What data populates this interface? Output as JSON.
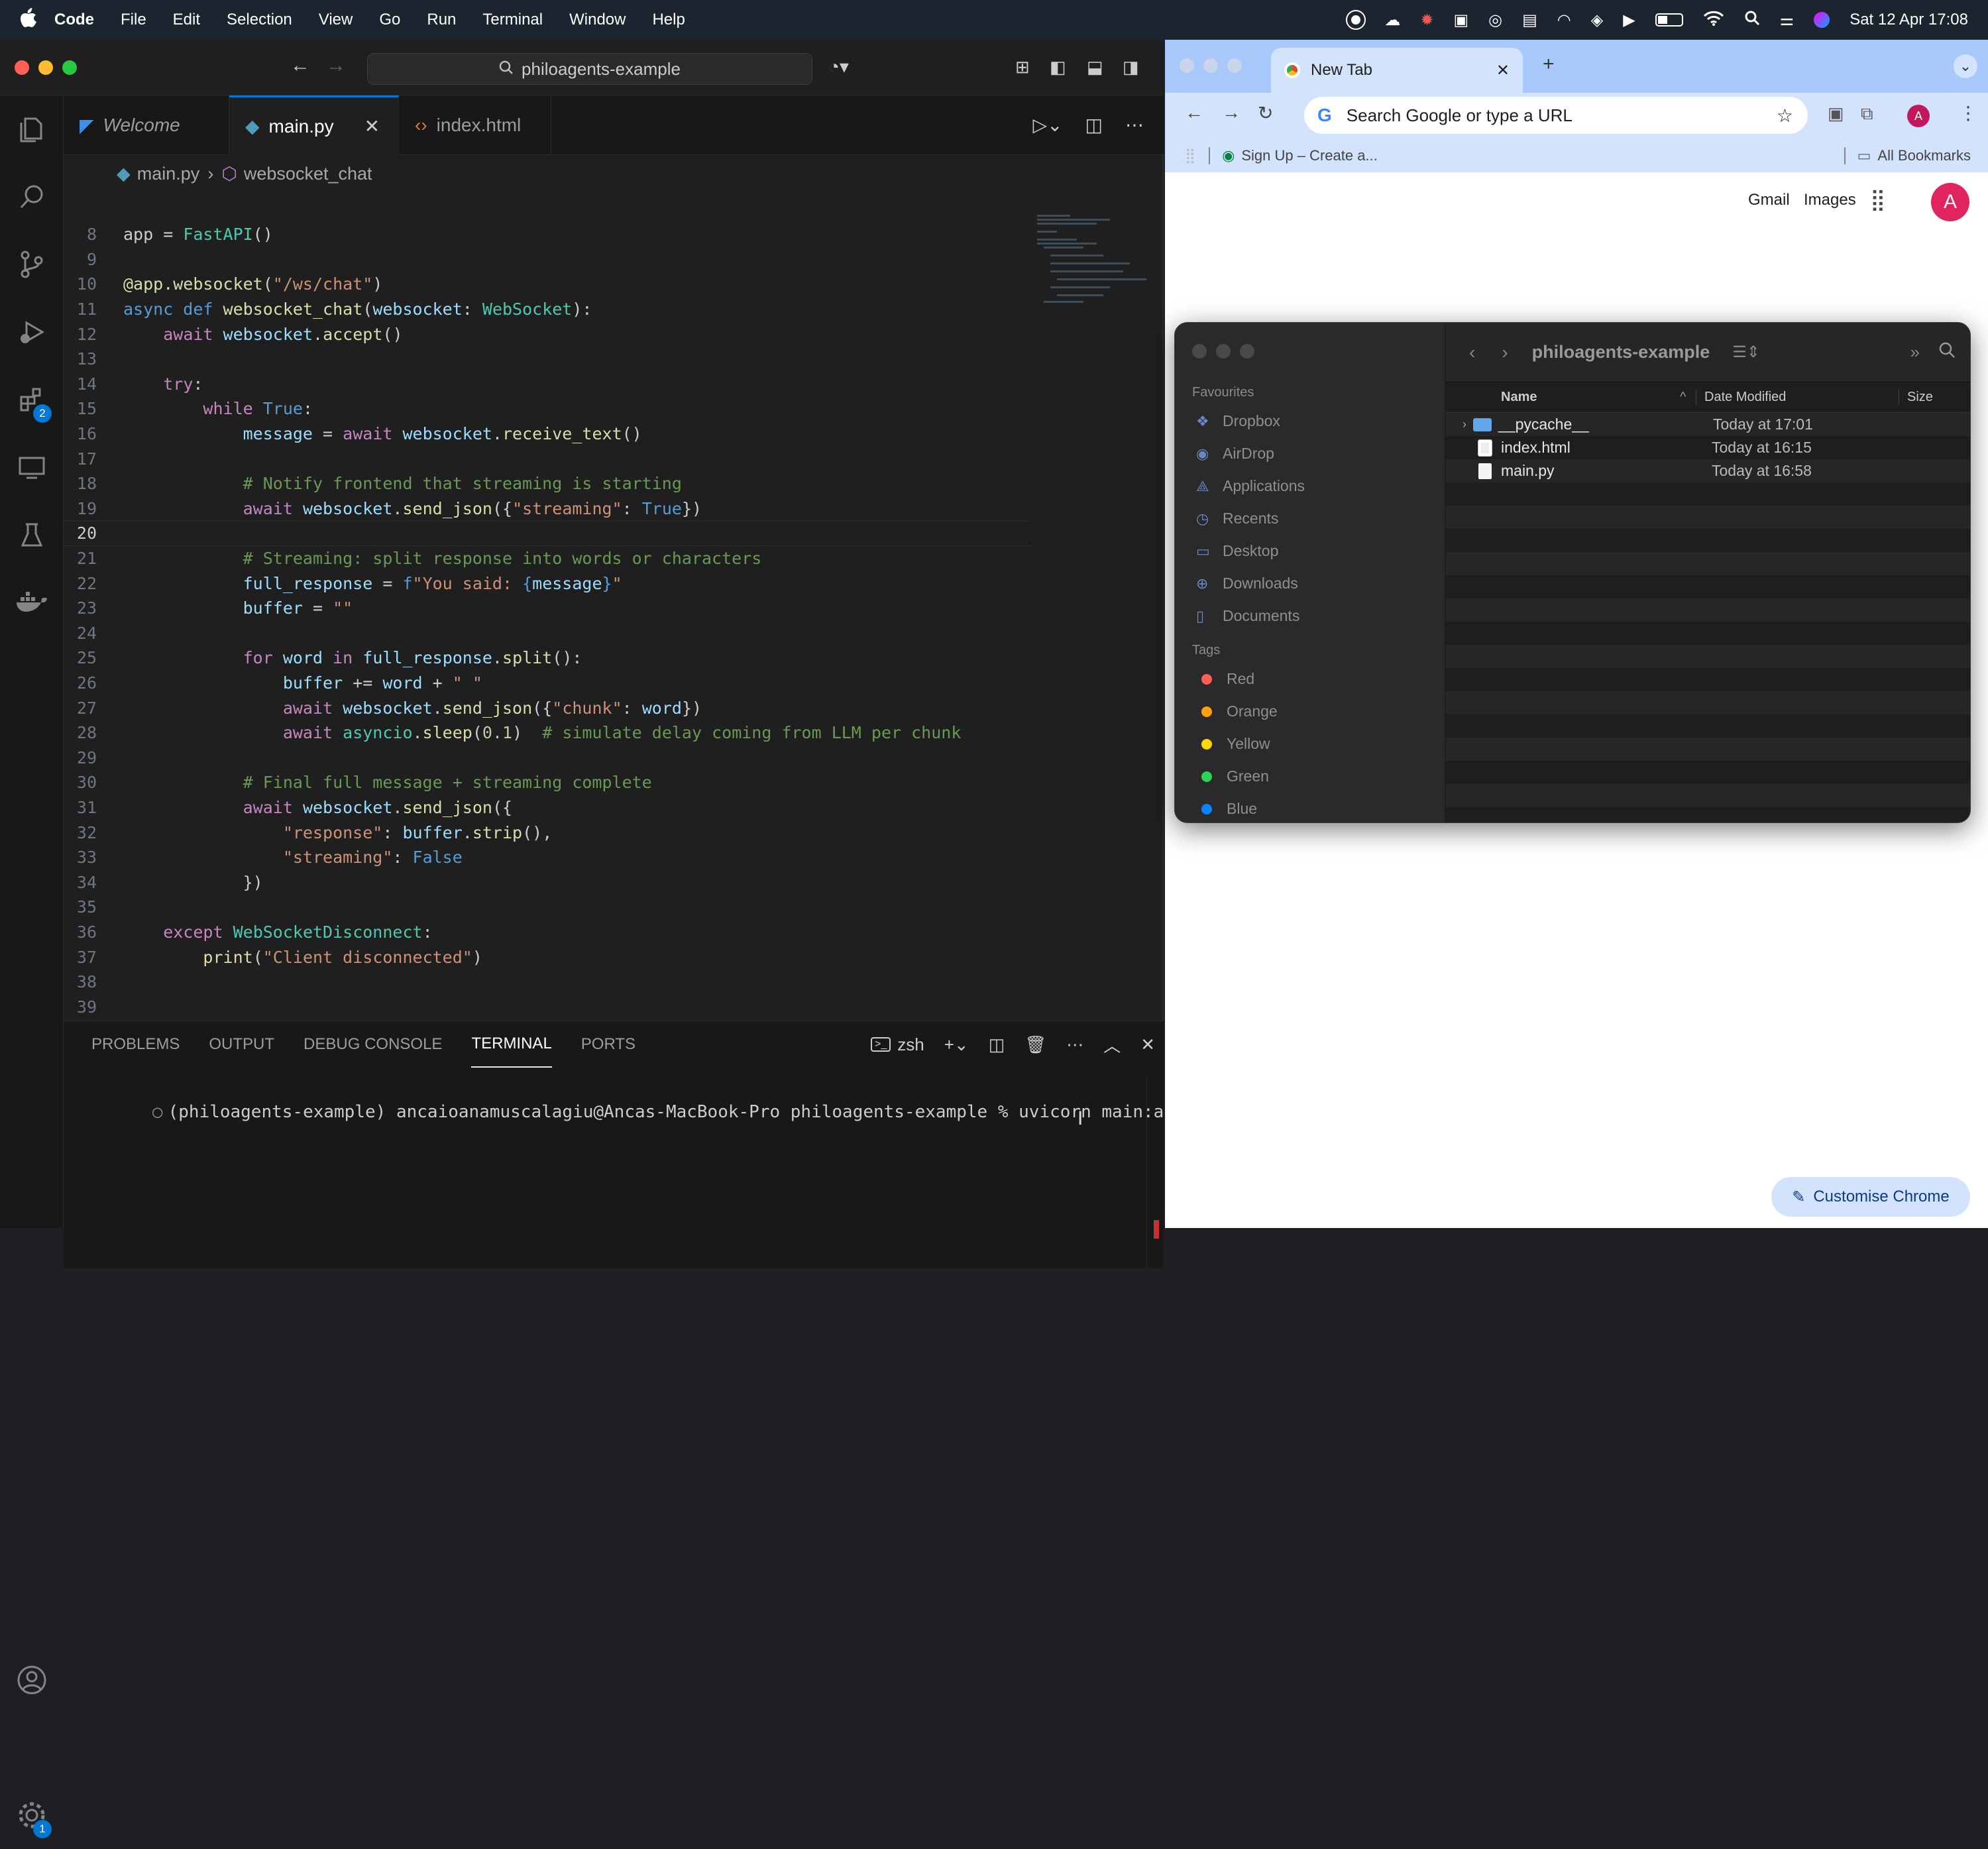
{
  "menubar": {
    "app": "Code",
    "items": [
      "File",
      "Edit",
      "Selection",
      "View",
      "Go",
      "Run",
      "Terminal",
      "Window",
      "Help"
    ],
    "datetime": "Sat 12 Apr  17:08"
  },
  "vscode": {
    "command_center": "philoagents-example",
    "tabs": [
      {
        "label": "Welcome"
      },
      {
        "label": "main.py"
      },
      {
        "label": "index.html"
      }
    ],
    "breadcrumb": {
      "file": "main.py",
      "symbol": "websocket_chat"
    },
    "activity_badges": {
      "extensions": "2",
      "settings": "1"
    },
    "code_lines": [
      {
        "n": "8",
        "html": "app = <span class='c'>FastAPI</span>()"
      },
      {
        "n": "9",
        "html": ""
      },
      {
        "n": "10",
        "html": "<span class='f'>@app.websocket</span>(<span class='s'>\"/ws/chat\"</span>)"
      },
      {
        "n": "11",
        "html": "<span class='b'>async def</span> <span class='f'>websocket_chat</span>(<span class='v'>websocket</span>: <span class='c'>WebSocket</span>):"
      },
      {
        "n": "12",
        "html": "    <span class='k'>await</span> <span class='v'>websocket</span>.<span class='f'>accept</span>()"
      },
      {
        "n": "13",
        "html": ""
      },
      {
        "n": "14",
        "html": "    <span class='k'>try</span>:"
      },
      {
        "n": "15",
        "html": "        <span class='k'>while</span> <span class='b'>True</span>:"
      },
      {
        "n": "16",
        "html": "            <span class='v'>message</span> = <span class='k'>await</span> <span class='v'>websocket</span>.<span class='f'>receive_text</span>()"
      },
      {
        "n": "17",
        "html": ""
      },
      {
        "n": "18",
        "html": "            <span class='cm'># Notify frontend that streaming is starting</span>"
      },
      {
        "n": "19",
        "html": "            <span class='k'>await</span> <span class='v'>websocket</span>.<span class='f'>send_json</span>({<span class='s'>\"streaming\"</span>: <span class='b'>True</span>})"
      },
      {
        "n": "20",
        "html": "",
        "cur": true
      },
      {
        "n": "21",
        "html": "            <span class='cm'># Streaming: split response into words or characters</span>"
      },
      {
        "n": "22",
        "html": "            <span class='v'>full_response</span> = <span class='b'>f</span><span class='s'>\"You said: </span><span class='b'>{</span><span class='v'>message</span><span class='b'>}</span><span class='s'>\"</span>"
      },
      {
        "n": "23",
        "html": "            <span class='v'>buffer</span> = <span class='s'>\"\"</span>"
      },
      {
        "n": "24",
        "html": ""
      },
      {
        "n": "25",
        "html": "            <span class='k'>for</span> <span class='v'>word</span> <span class='k'>in</span> <span class='v'>full_response</span>.<span class='f'>split</span>():"
      },
      {
        "n": "26",
        "html": "                <span class='v'>buffer</span> += <span class='v'>word</span> + <span class='s'>\" \"</span>"
      },
      {
        "n": "27",
        "html": "                <span class='k'>await</span> <span class='v'>websocket</span>.<span class='f'>send_json</span>({<span class='s'>\"chunk\"</span>: <span class='v'>word</span>})"
      },
      {
        "n": "28",
        "html": "                <span class='k'>await</span> <span class='c'>asyncio</span>.<span class='f'>sleep</span>(<span class='n'>0.1</span>)  <span class='cm'># simulate delay coming from LLM per chunk</span>"
      },
      {
        "n": "29",
        "html": ""
      },
      {
        "n": "30",
        "html": "            <span class='cm'># Final full message + streaming complete</span>"
      },
      {
        "n": "31",
        "html": "            <span class='k'>await</span> <span class='v'>websocket</span>.<span class='f'>send_json</span>({"
      },
      {
        "n": "32",
        "html": "                <span class='s'>\"response\"</span>: <span class='v'>buffer</span>.<span class='f'>strip</span>(),"
      },
      {
        "n": "33",
        "html": "                <span class='s'>\"streaming\"</span>: <span class='b'>False</span>"
      },
      {
        "n": "34",
        "html": "            })"
      },
      {
        "n": "35",
        "html": ""
      },
      {
        "n": "36",
        "html": "    <span class='k'>except</span> <span class='c'>WebSocketDisconnect</span>:"
      },
      {
        "n": "37",
        "html": "        <span class='f'>print</span>(<span class='s'>\"Client disconnected\"</span>)"
      },
      {
        "n": "38",
        "html": ""
      },
      {
        "n": "39",
        "html": ""
      }
    ],
    "panel_tabs": [
      "PROBLEMS",
      "OUTPUT",
      "DEBUG CONSOLE",
      "TERMINAL",
      "PORTS"
    ],
    "terminal_shell": "zsh",
    "terminal_prompt": "(philoagents-example) ancaioanamuscalagiu@Ancas-MacBook-Pro philoagents-example % uvicorn main:app"
  },
  "chrome": {
    "tab_title": "New Tab",
    "omnibox_placeholder": "Search Google or type a URL",
    "bookmark": "Sign Up – Create a...",
    "all_bookmarks": "All Bookmarks",
    "links": [
      "Gmail",
      "Images"
    ],
    "avatar": "A",
    "profile_initial": "A",
    "customise": "Customise Chrome"
  },
  "finder": {
    "title": "philoagents-example",
    "favourites_label": "Favourites",
    "favourites": [
      "Dropbox",
      "AirDrop",
      "Applications",
      "Recents",
      "Desktop",
      "Downloads",
      "Documents"
    ],
    "tags_label": "Tags",
    "tags": [
      {
        "name": "Red",
        "color": "#ff5f57"
      },
      {
        "name": "Orange",
        "color": "#ff9f0a"
      },
      {
        "name": "Yellow",
        "color": "#ffd60a"
      },
      {
        "name": "Green",
        "color": "#30d158"
      },
      {
        "name": "Blue",
        "color": "#0a84ff"
      }
    ],
    "columns": {
      "name": "Name",
      "date": "Date Modified",
      "size": "Size"
    },
    "files": [
      {
        "name": "__pycache__",
        "date": "Today at 17:01",
        "kind": "folder"
      },
      {
        "name": "index.html",
        "date": "Today at 16:15",
        "kind": "html"
      },
      {
        "name": "main.py",
        "date": "Today at 16:58",
        "kind": "doc"
      }
    ]
  }
}
